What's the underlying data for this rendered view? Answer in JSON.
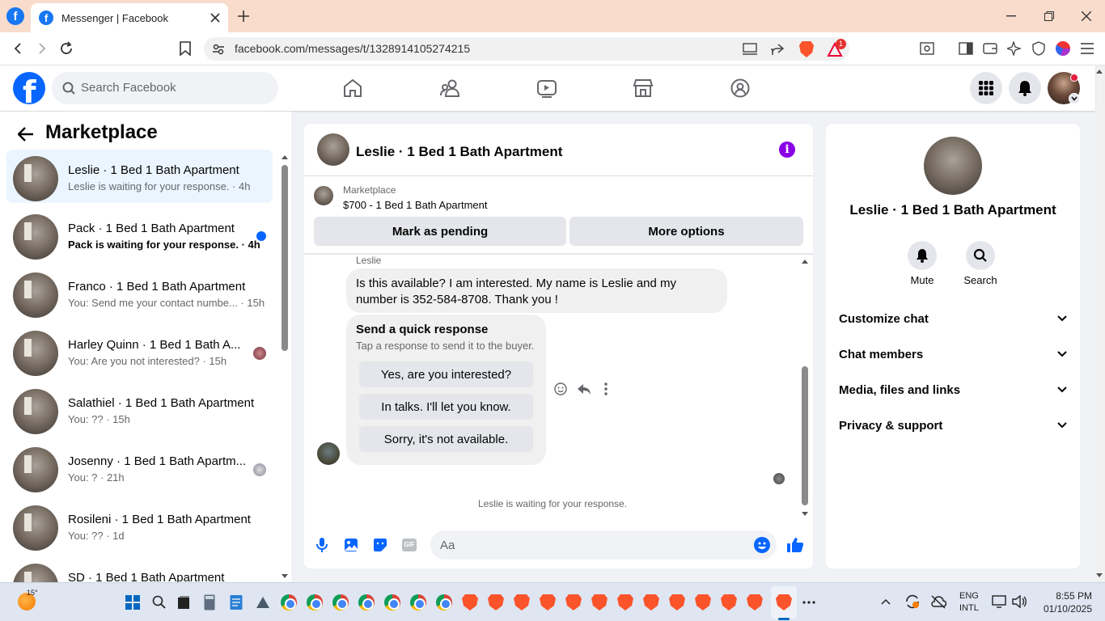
{
  "browser": {
    "tab_title": "Messenger | Facebook",
    "url": "facebook.com/messages/t/1328914105274215",
    "brave_badge": "1"
  },
  "fb": {
    "search_placeholder": "Search Facebook"
  },
  "left": {
    "title": "Marketplace",
    "conversations": [
      {
        "name": "Leslie · 1 Bed 1 Bath Apartment",
        "preview": "Leslie is waiting for your response. · 4h",
        "selected": true,
        "unread": false
      },
      {
        "name": "Pack · 1 Bed 1 Bath Apartment",
        "preview": "Pack is waiting for your response. · 4h",
        "selected": false,
        "unread": true
      },
      {
        "name": "Franco · 1 Bed 1 Bath Apartment",
        "preview": "You: Send me your contact numbe... · 15h",
        "selected": false,
        "unread": false
      },
      {
        "name": "Harley Quinn · 1 Bed 1 Bath A...",
        "preview": "You: Are you not interested? · 15h",
        "selected": false,
        "unread": false
      },
      {
        "name": "Salathiel · 1 Bed 1 Bath Apartment",
        "preview": "You: ?? · 15h",
        "selected": false,
        "unread": false
      },
      {
        "name": "Josenny · 1 Bed 1 Bath Apartm...",
        "preview": "You: ? · 21h",
        "selected": false,
        "unread": false
      },
      {
        "name": "Rosileni · 1 Bed 1 Bath Apartment",
        "preview": "You: ?? · 1d",
        "selected": false,
        "unread": false
      },
      {
        "name": "SD · 1 Bed 1 Bath Apartment",
        "preview": "",
        "selected": false,
        "unread": false
      }
    ]
  },
  "chat": {
    "title": "Leslie · 1 Bed 1 Bath Apartment",
    "listing_source": "Marketplace",
    "listing_title": "$700 - 1 Bed 1 Bath Apartment",
    "mark_pending": "Mark as pending",
    "more_options": "More options",
    "sender": "Leslie",
    "message": "Is this available? I am interested.  My name is Leslie and my number is 352-584-8708. Thank you !",
    "quick_title": "Send a quick response",
    "quick_sub": "Tap a response to send it to the buyer.",
    "quick_1": "Yes, are you interested?",
    "quick_2": "In talks. I'll let you know.",
    "quick_3": "Sorry, it's not available.",
    "status": "Leslie is waiting for your response.",
    "input_placeholder": "Aa"
  },
  "right": {
    "name": "Leslie · 1 Bed 1 Bath Apartment",
    "mute": "Mute",
    "search": "Search",
    "sections": [
      "Customize chat",
      "Chat members",
      "Media, files and links",
      "Privacy & support"
    ]
  },
  "taskbar": {
    "temp": "15°",
    "lang1": "ENG",
    "lang2": "INTL",
    "time": "8:55 PM",
    "date": "01/10/2025"
  },
  "colors": {
    "fb_blue": "#0866ff",
    "purple_info": "#8a00e6",
    "tab_bar": "#f9dccb",
    "brave": "#fb542b"
  }
}
